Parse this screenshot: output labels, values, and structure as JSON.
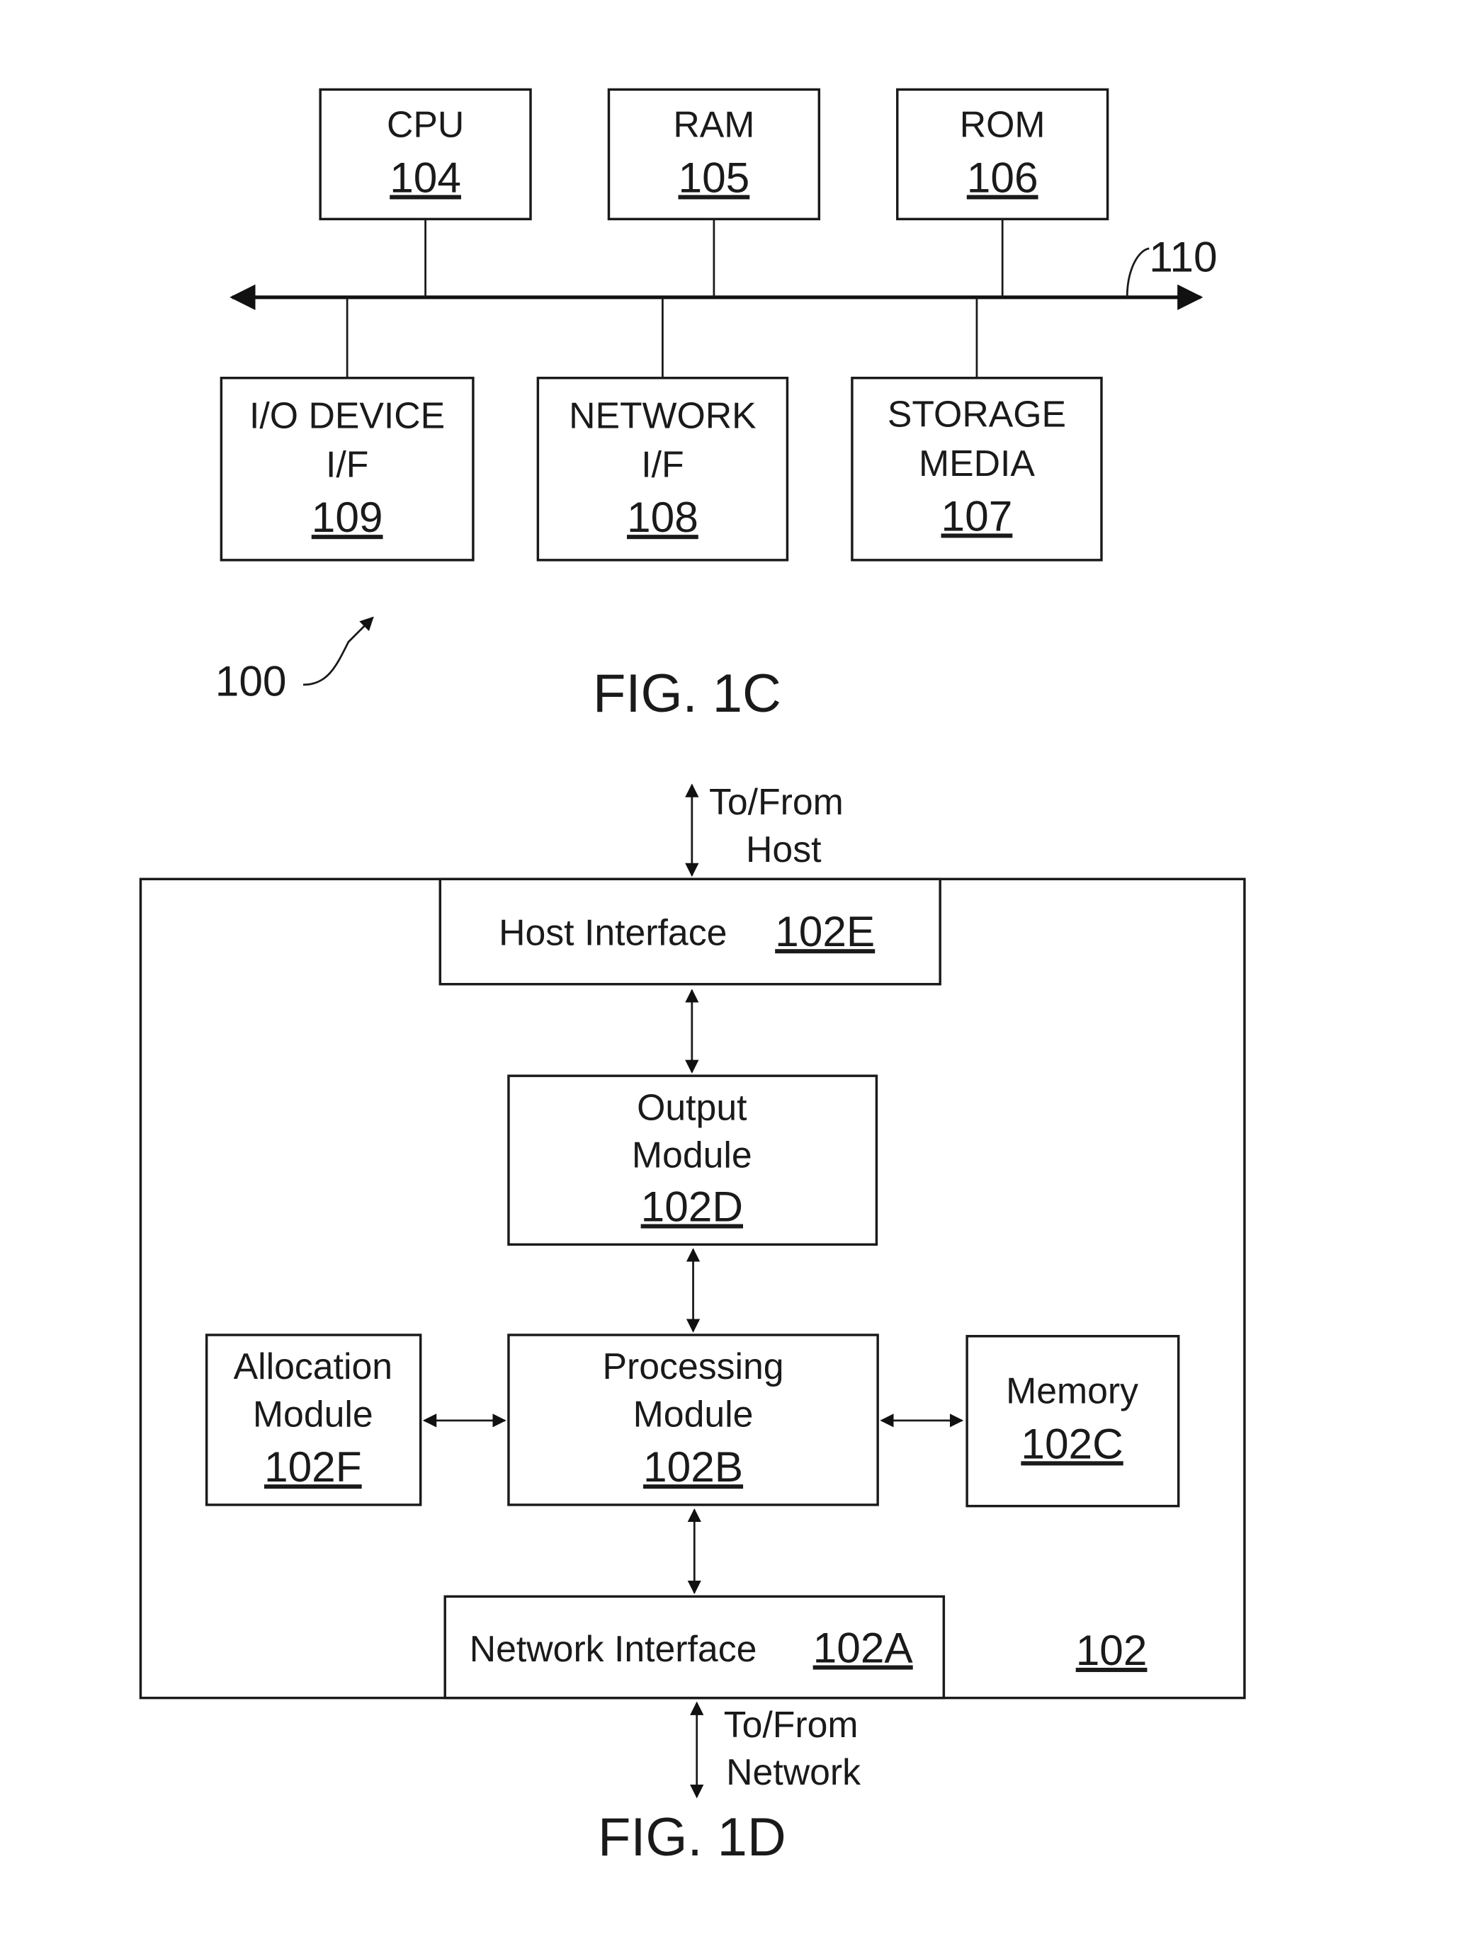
{
  "fig1c": {
    "caption": "FIG. 1C",
    "system_ref": "100",
    "bus_ref": "110",
    "top_components": [
      {
        "label": "CPU",
        "ref": "104"
      },
      {
        "label": "RAM",
        "ref": "105"
      },
      {
        "label": "ROM",
        "ref": "106"
      }
    ],
    "bottom_components": [
      {
        "label_line1": "I/O DEVICE",
        "label_line2": "I/F",
        "ref": "109"
      },
      {
        "label_line1": "NETWORK",
        "label_line2": "I/F",
        "ref": "108"
      },
      {
        "label_line1": "STORAGE",
        "label_line2": "MEDIA",
        "ref": "107"
      }
    ]
  },
  "fig1d": {
    "caption": "FIG. 1D",
    "device_ref": "102",
    "host_io": {
      "line1": "To/From",
      "line2": "Host"
    },
    "network_io": {
      "line1": "To/From",
      "line2": "Network"
    },
    "host_interface": {
      "label": "Host Interface",
      "ref": "102E"
    },
    "output_module": {
      "line1": "Output",
      "line2": "Module",
      "ref": "102D"
    },
    "allocation_module": {
      "line1": "Allocation",
      "line2": "Module",
      "ref": "102F"
    },
    "processing_module": {
      "line1": "Processing",
      "line2": "Module",
      "ref": "102B"
    },
    "memory": {
      "label": "Memory",
      "ref": "102C"
    },
    "network_interface": {
      "label": "Network Interface",
      "ref": "102A"
    }
  }
}
